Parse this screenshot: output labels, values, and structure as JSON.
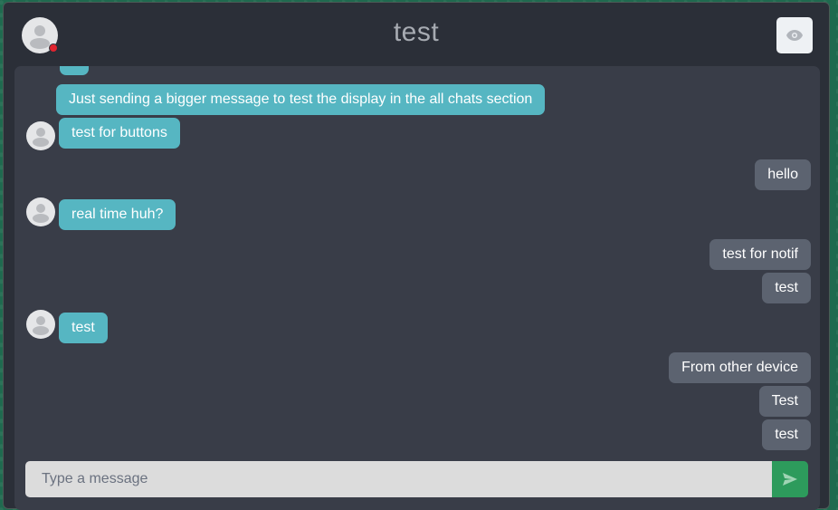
{
  "header": {
    "title": "test",
    "eye_icon": "eye-icon",
    "status_color": "#e0242f"
  },
  "messages": [
    {
      "dir": "in",
      "text": "Just sending a bigger message to test the display in the all chats section"
    },
    {
      "dir": "in",
      "text": "test for buttons"
    },
    {
      "dir": "out",
      "text": "hello"
    },
    {
      "dir": "in",
      "text": "real time huh?"
    },
    {
      "dir": "out",
      "text": "test for notif"
    },
    {
      "dir": "out",
      "text": "test"
    },
    {
      "dir": "in",
      "text": "test"
    },
    {
      "dir": "out",
      "text": "From other device"
    },
    {
      "dir": "out",
      "text": "Test"
    },
    {
      "dir": "out",
      "text": "test"
    }
  ],
  "composer": {
    "placeholder": "Type a message",
    "send_icon": "send-icon"
  },
  "colors": {
    "incoming": "#56b6c2",
    "outgoing": "#5c6370",
    "send": "#2d9b5c"
  }
}
